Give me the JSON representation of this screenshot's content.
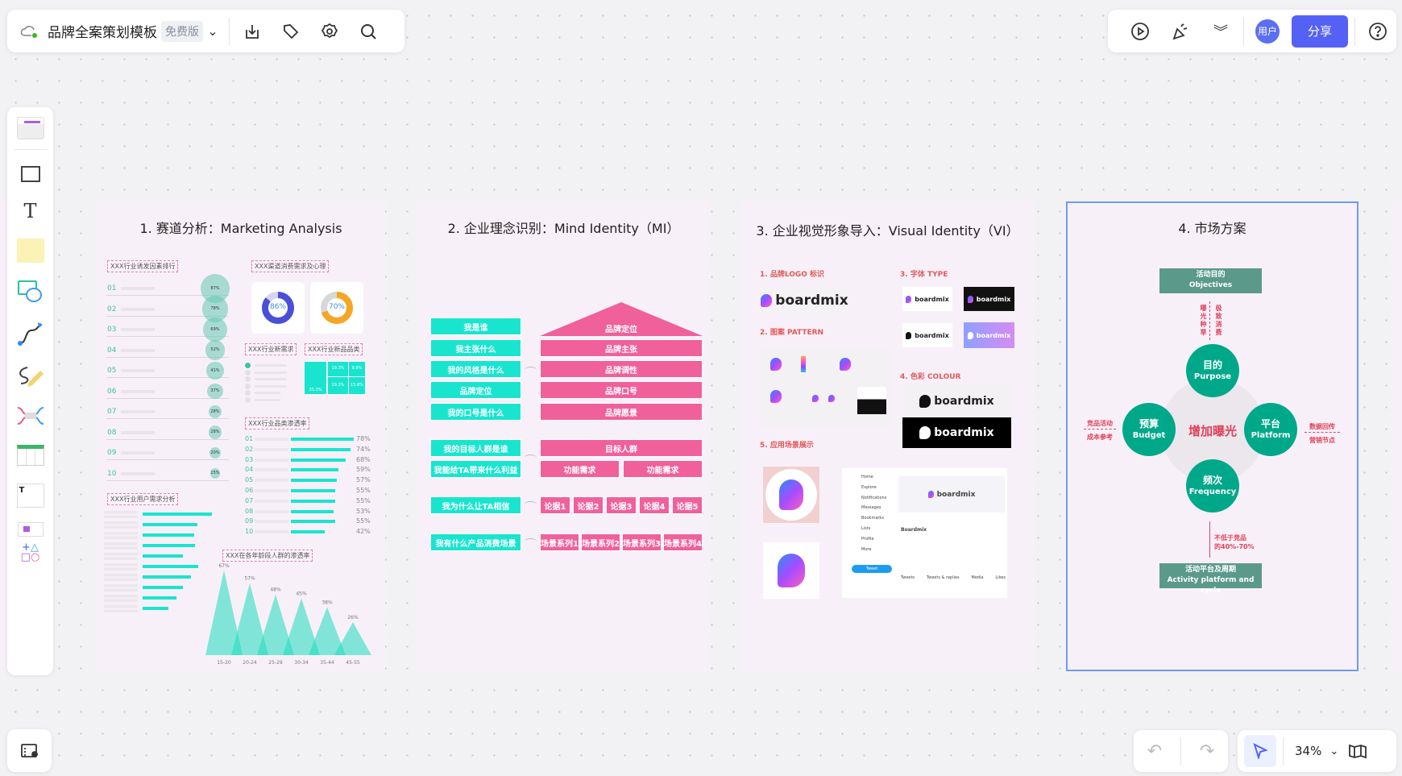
{
  "header": {
    "title": "品牌全案策划模板",
    "plan_badge": "免费版"
  },
  "toolbar_right": {
    "avatar": "用户",
    "share": "分享"
  },
  "zoom": {
    "level": "34%"
  },
  "colors": {
    "accent": "#5561f5",
    "teal": "#19e5cf",
    "pink": "#f0609b",
    "green": "#00a88a",
    "selection": "#6e9cf0"
  },
  "frames": {
    "f1": {
      "title": "1.  赛道分析：Marketing Analysis",
      "ranking": {
        "label": "XXX行业诱发因素排行",
        "rows": [
          {
            "no": "01",
            "value": "87%",
            "percent": 87
          },
          {
            "no": "02",
            "value": "78%",
            "percent": 78
          },
          {
            "no": "03",
            "value": "69%",
            "percent": 69
          },
          {
            "no": "04",
            "value": "52%",
            "percent": 52
          },
          {
            "no": "05",
            "value": "41%",
            "percent": 41
          },
          {
            "no": "06",
            "value": "37%",
            "percent": 37
          },
          {
            "no": "07",
            "value": "28%",
            "percent": 28
          },
          {
            "no": "08",
            "value": "28%",
            "percent": 28
          },
          {
            "no": "09",
            "value": "20%",
            "percent": 20
          },
          {
            "no": "10",
            "value": "15%",
            "percent": 15
          }
        ]
      },
      "consumer": {
        "label": "XXX渠道消费需求及心理",
        "donuts": [
          {
            "value": "86%",
            "percent": 86,
            "color": "#4a4fd8"
          },
          {
            "value": "70%",
            "percent": 70,
            "color": "#f5a623"
          }
        ]
      },
      "new_demand": {
        "label": "XXX行业新需求"
      },
      "new_category": {
        "label": "XXX行业新品品类",
        "cells": [
          "35.3%",
          "19.3%",
          "9.8%",
          "19.3%",
          "15.8%"
        ]
      },
      "penetration": {
        "label": "XXX行业品类渗透率",
        "rows": [
          {
            "no": "01",
            "value": "78%",
            "percent": 78
          },
          {
            "no": "02",
            "value": "74%",
            "percent": 74
          },
          {
            "no": "03",
            "value": "68%",
            "percent": 68
          },
          {
            "no": "04",
            "value": "59%",
            "percent": 59
          },
          {
            "no": "05",
            "value": "57%",
            "percent": 57
          },
          {
            "no": "06",
            "value": "55%",
            "percent": 55
          },
          {
            "no": "07",
            "value": "55%",
            "percent": 55
          },
          {
            "no": "08",
            "value": "53%",
            "percent": 53
          },
          {
            "no": "09",
            "value": "55%",
            "percent": 55
          },
          {
            "no": "10",
            "value": "42%",
            "percent": 42
          }
        ]
      },
      "user_demand": {
        "label": "XXX行业用户需求分析",
        "levels": [
          1,
          0.79,
          0.74,
          0.76,
          0.58,
          0.8,
          0.7,
          0.58,
          0.49,
          0.37
        ]
      },
      "age": {
        "label": "XXX在各年龄段人群的渗透率",
        "groups": [
          {
            "age": "15-20",
            "value": "67%",
            "percent": 67
          },
          {
            "age": "20-24",
            "value": "57%",
            "percent": 57
          },
          {
            "age": "25-29",
            "value": "48%",
            "percent": 48
          },
          {
            "age": "30-34",
            "value": "45%",
            "percent": 45
          },
          {
            "age": "35-44",
            "value": "38%",
            "percent": 38
          },
          {
            "age": "45-55",
            "value": "26%",
            "percent": 26
          }
        ]
      }
    },
    "f2": {
      "title": "2.  企业理念识别：Mind Identity（MI）",
      "pyramid": [
        {
          "q": "我是谁",
          "a": "品牌定位"
        },
        {
          "q": "我主张什么",
          "a": "品牌主张"
        },
        {
          "q": "我的风格是什么",
          "a": "品牌调性"
        },
        {
          "q": "品牌定位",
          "a": "品牌口号"
        },
        {
          "q": "我的口号是什么",
          "a": "品牌愿景"
        }
      ],
      "target": {
        "questions": [
          "我的目标人群是谁",
          "我能给TA带来什么利益"
        ],
        "top": "目标人群",
        "subs": [
          "功能需求",
          "功能需求"
        ]
      },
      "trust": {
        "q": "我为什么让TA相信",
        "items": [
          "论据1",
          "论据2",
          "论据3",
          "论据4",
          "论据5"
        ]
      },
      "scene": {
        "q": "我有什么产品消费场景",
        "items": [
          "场景系列1",
          "场景系列2",
          "场景系列3",
          "场景系列4"
        ]
      }
    },
    "f3": {
      "title": "3.  企业视觉形象导入：Visual Identity（VI）",
      "sections": {
        "logo": "1.  品牌LOGO 标识",
        "pattern": "2.  图案 PATTERN",
        "type": "3.  字体 TYPE",
        "colour": "4.  色彩 COLOUR",
        "app": "5.  应用场景展示"
      },
      "brand": "boardmix",
      "social": {
        "nav": [
          "Home",
          "Explore",
          "Notifications",
          "Messages",
          "Bookmarks",
          "Lists",
          "Profile",
          "More"
        ],
        "tweet": "Tweet",
        "name": "Boardmix",
        "tabs": [
          "Tweets",
          "Tweets & replies",
          "Media",
          "Likes"
        ]
      }
    },
    "f4": {
      "title": "4.  市场方案",
      "objectives": {
        "cn": "活动目的",
        "en": "Objectives"
      },
      "side_left_vertical": "曝光种草",
      "side_right_vertical": "极致消费",
      "center": "增加曝光",
      "circles": {
        "purpose": {
          "cn": "目的",
          "en": "Purpose"
        },
        "budget": {
          "cn": "预算",
          "en": "Budget"
        },
        "platform": {
          "cn": "平台",
          "en": "Platform"
        },
        "frequency": {
          "cn": "频次",
          "en": "Frequency"
        }
      },
      "left_note": [
        "竞品活动",
        "成本参考"
      ],
      "right_note": [
        "数据回传",
        "营销节点"
      ],
      "bottom_note": [
        "不低于竞品",
        "的40%-70%"
      ],
      "activity": {
        "cn": "活动平台及周期",
        "en": "Activity platform and cycle"
      }
    }
  }
}
